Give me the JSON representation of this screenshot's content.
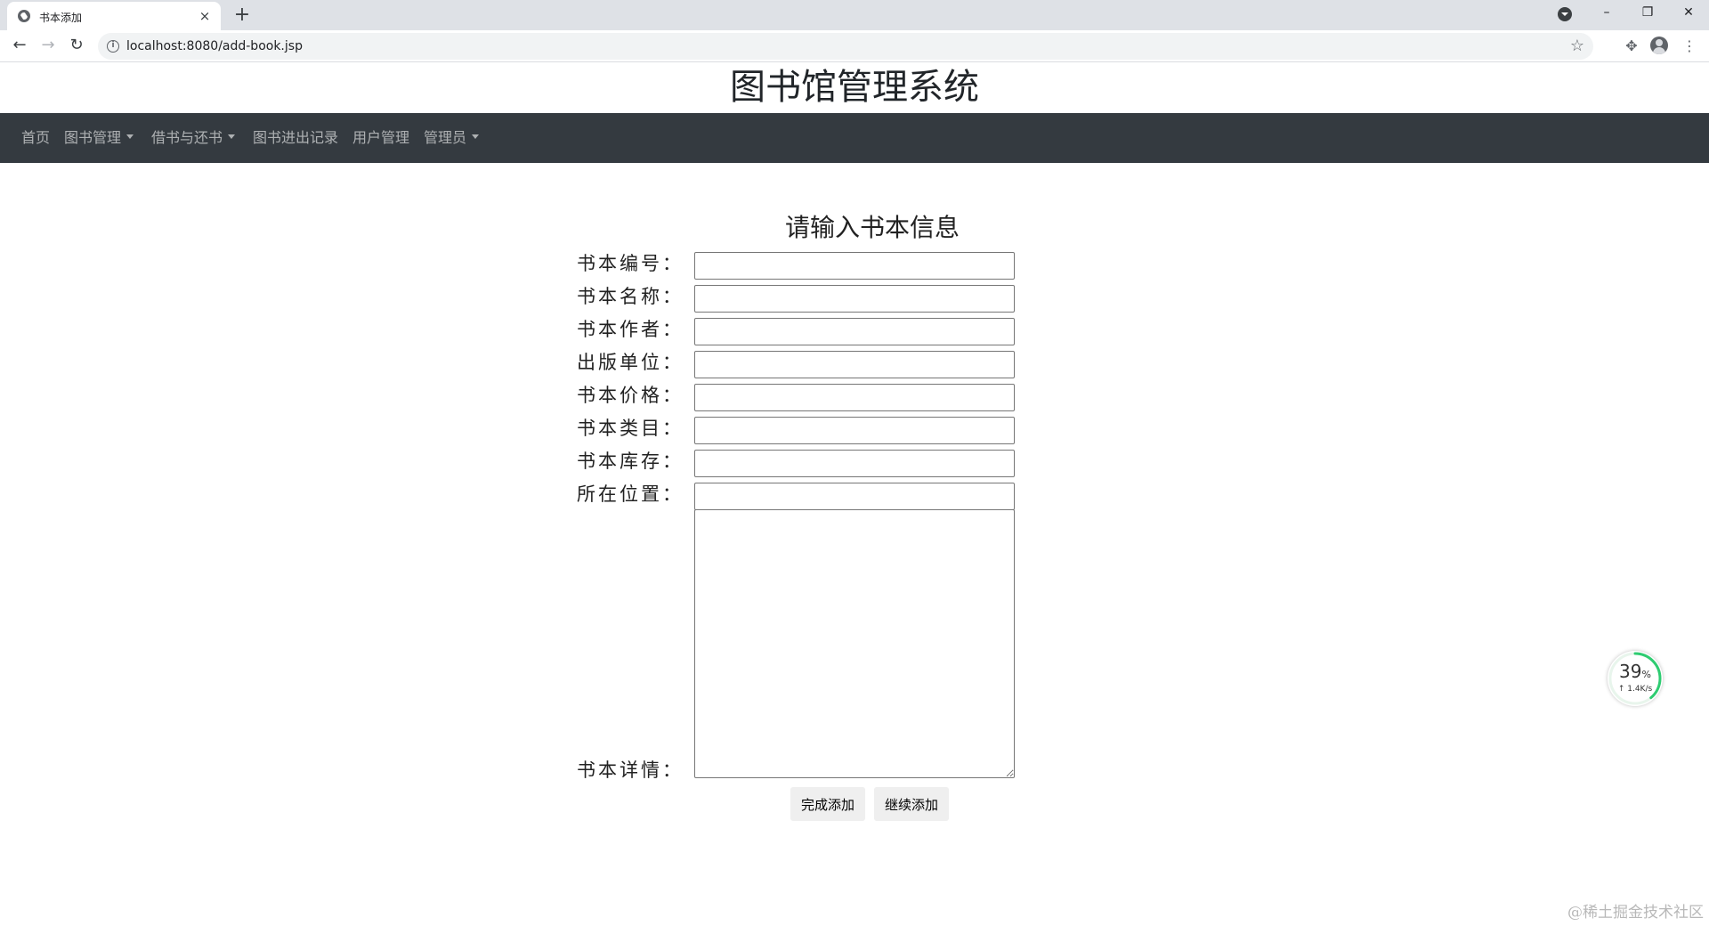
{
  "browser": {
    "tab_title": "书本添加",
    "tab_close": "×",
    "new_tab": "+",
    "url": "localhost:8080/add-book.jsp",
    "window_controls": {
      "minimize": "–",
      "restore": "❐",
      "close": "✕"
    }
  },
  "header": {
    "title": "图书馆管理系统"
  },
  "navbar": {
    "items": [
      {
        "label": "首页",
        "dropdown": false
      },
      {
        "label": "图书管理",
        "dropdown": true
      },
      {
        "label": "借书与还书",
        "dropdown": true
      },
      {
        "label": "图书进出记录",
        "dropdown": false
      },
      {
        "label": "用户管理",
        "dropdown": false
      },
      {
        "label": "管理员",
        "dropdown": true
      }
    ]
  },
  "form": {
    "heading": "请输入书本信息",
    "fields": [
      {
        "label": "书本编号：",
        "value": ""
      },
      {
        "label": "书本名称：",
        "value": ""
      },
      {
        "label": "书本作者：",
        "value": ""
      },
      {
        "label": "出版单位：",
        "value": ""
      },
      {
        "label": "书本价格：",
        "value": ""
      },
      {
        "label": "书本类目：",
        "value": ""
      },
      {
        "label": "书本库存：",
        "value": ""
      },
      {
        "label": "所在位置：",
        "value": ""
      }
    ],
    "details_label": "书本详情：",
    "details_value": "",
    "buttons": {
      "finish": "完成添加",
      "continue": "继续添加"
    }
  },
  "speed_widget": {
    "percent": "39",
    "percent_unit": "%",
    "rate": "↑ 1.4K/s",
    "progress": 0.39,
    "color": "#2ecc71"
  },
  "watermark": "@稀土掘金技术社区",
  "colors": {
    "navbar_bg": "#343a40",
    "tabbar_bg": "#dee1e6"
  }
}
